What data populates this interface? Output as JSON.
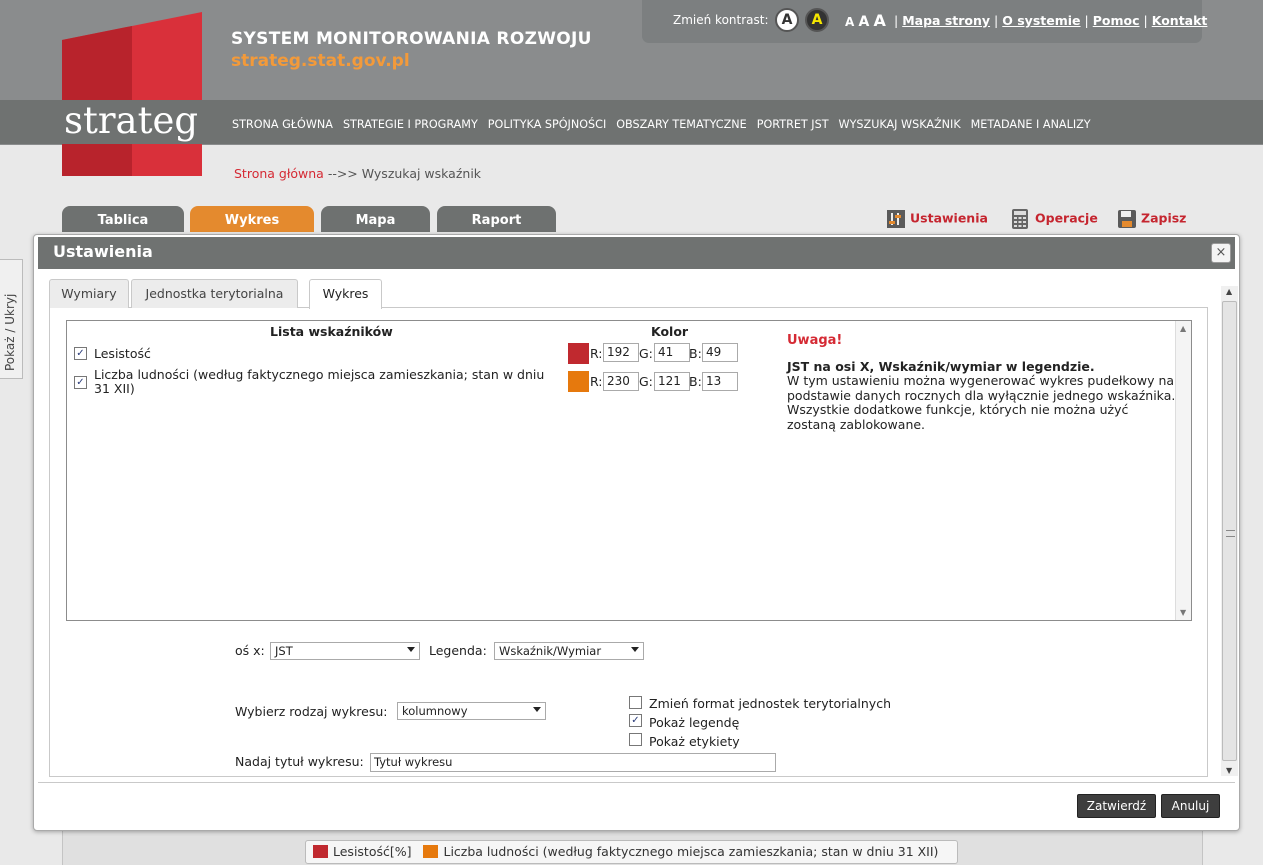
{
  "site": {
    "title": "SYSTEM MONITOROWANIA ROZWOJU",
    "url": "strateg.stat.gov.pl",
    "logo_text": "strateg"
  },
  "topbar": {
    "contrast_label": "Zmień kontrast:",
    "contrast_a1": "A",
    "contrast_a2": "A",
    "font_sizes": "A A A",
    "links": [
      "Mapa strony",
      "O systemie",
      "Pomoc",
      "Kontakt"
    ]
  },
  "nav": {
    "items": [
      "STRONA GŁÓWNA",
      "STRATEGIE I PROGRAMY",
      "POLITYKA SPÓJNOŚCI",
      "OBSZARY TEMATYCZNE",
      "PORTRET JST",
      "WYSZUKAJ WSKAŹNIK",
      "METADANE I ANALIZY"
    ]
  },
  "breadcrumb": {
    "home": "Strona główna",
    "sep": " -->> ",
    "current": "Wyszukaj wskaźnik"
  },
  "main_tabs": [
    "Tablica",
    "Wykres",
    "Mapa",
    "Raport"
  ],
  "toolbar": {
    "settings": "Ustawienia",
    "operations": "Operacje",
    "save": "Zapisz"
  },
  "side_toggle": "Pokaż / Ukryj",
  "dialog": {
    "title": "Ustawienia",
    "close": "×",
    "subtabs": [
      "Wymiary",
      "Jednostka terytorialna",
      "Wykres"
    ],
    "list_header": "Lista wskaźników",
    "color_header": "Kolor",
    "indicators": [
      {
        "label": "Lesistość",
        "checked": "✓",
        "color": "#c0292f",
        "r": "192",
        "g": "41",
        "b": "49"
      },
      {
        "label": "Liczba ludności (według faktycznego miejsca zamieszkania; stan w dniu 31 XII)",
        "checked": "✓",
        "color": "#e6790d",
        "r": "230",
        "g": "121",
        "b": "13"
      }
    ],
    "rgb_labels": {
      "r": "R:",
      "g": "G:",
      "b": "B:"
    },
    "note": {
      "title": "Uwaga!",
      "bold": "JST na osi X, Wskaźnik/wymiar w legendzie.",
      "text": "W tym ustawieniu można wygenerować wykres pudełkowy na podstawie danych rocznych dla wyłącznie jednego wskaźnika. Wszystkie dodatkowe funkcje, których nie można użyć zostaną zablokowane."
    },
    "x_axis_label": "oś x:",
    "x_axis_value": "JST",
    "legend_label": "Legenda:",
    "legend_value": "Wskaźnik/Wymiar",
    "chart_type_label": "Wybierz rodzaj wykresu:",
    "chart_type_value": "kolumnowy",
    "title_label": "Nadaj tytuł wykresu:",
    "title_value": "Tytuł wykresu",
    "options": [
      {
        "label": "Zmień format jednostek terytorialnych",
        "checked": ""
      },
      {
        "label": "Pokaż legendę",
        "checked": "✓"
      },
      {
        "label": "Pokaż etykiety",
        "checked": ""
      }
    ],
    "confirm": "Zatwierdź",
    "cancel": "Anuluj"
  },
  "legend": [
    {
      "label": "Lesistość[%]",
      "color": "#c0292f"
    },
    {
      "label": "Liczba ludności (według faktycznego miejsca zamieszkania; stan w dniu 31 XII)",
      "color": "#e6790d"
    }
  ]
}
